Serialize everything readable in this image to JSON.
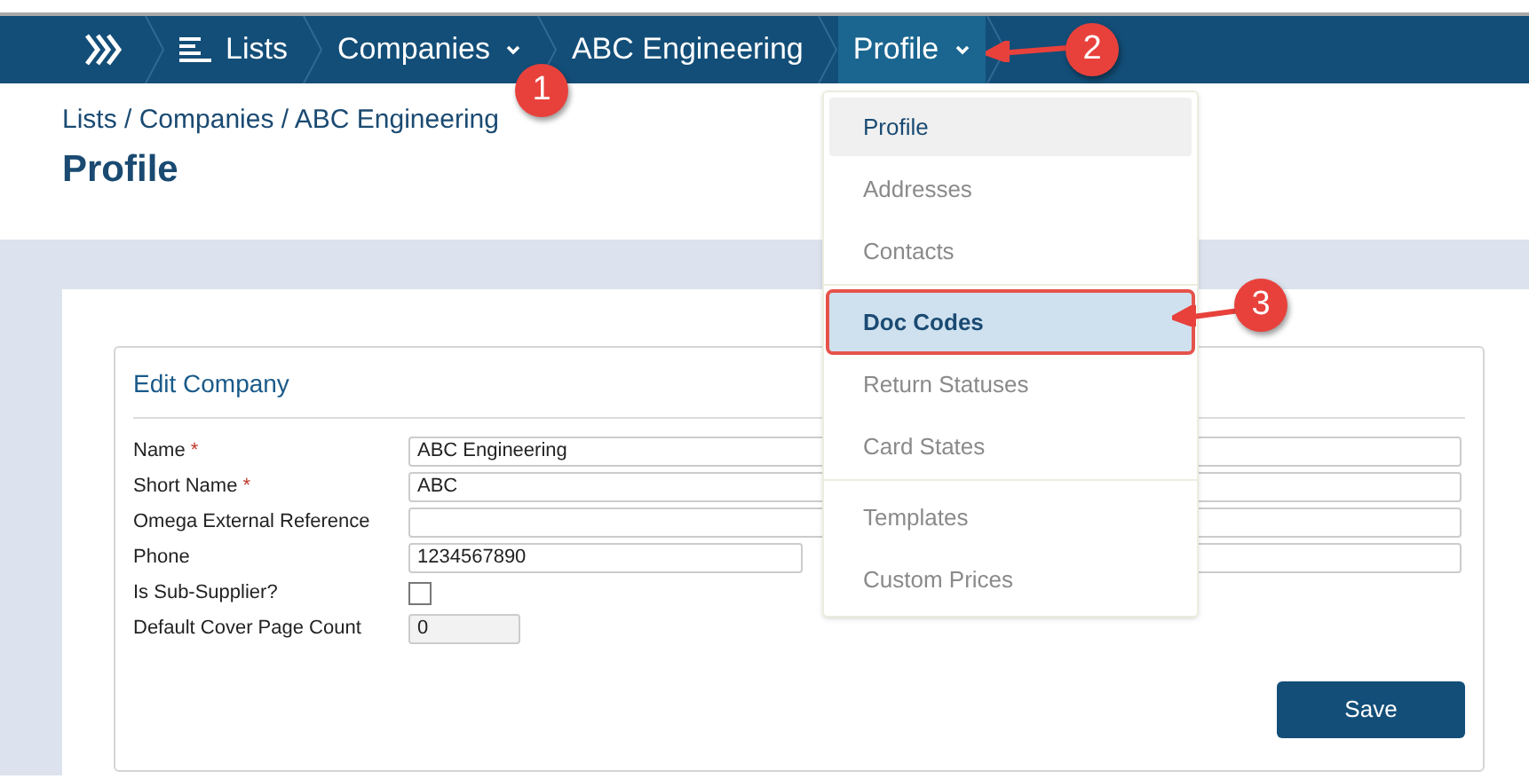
{
  "nav": {
    "items": [
      {
        "kind": "lists",
        "label": "Lists",
        "dropdown": false,
        "selected": false
      },
      {
        "kind": "plain",
        "label": "Companies",
        "dropdown": true,
        "selected": false
      },
      {
        "kind": "plain",
        "label": "ABC Engineering",
        "dropdown": false,
        "selected": false
      },
      {
        "kind": "plain",
        "label": "Profile",
        "dropdown": true,
        "selected": true
      }
    ]
  },
  "breadcrumb": "Lists / Companies / ABC Engineering",
  "title": "Profile",
  "form": {
    "title": "Edit Company",
    "fields": [
      {
        "kind": "text",
        "label": "Name",
        "required_mark": "*",
        "value": "ABC Engineering"
      },
      {
        "kind": "text",
        "label": "Short Name",
        "required_mark": "*",
        "value": "ABC"
      },
      {
        "kind": "text",
        "label": "Omega External Reference"
      },
      {
        "kind": "split",
        "label": "Phone",
        "value": "1234567890"
      },
      {
        "kind": "checkbox",
        "label": "Is Sub-Supplier?",
        "checked": false
      },
      {
        "kind": "number",
        "label": "Default Cover Page Count",
        "value": "0"
      }
    ],
    "save": "Save"
  },
  "menu": {
    "groups": [
      [
        {
          "label": "Profile",
          "selected": true,
          "hovered": false
        },
        {
          "label": "Addresses",
          "selected": false,
          "hovered": false
        },
        {
          "label": "Contacts",
          "selected": false,
          "hovered": false
        }
      ],
      [
        {
          "label": "Doc Codes",
          "selected": false,
          "hovered": true
        },
        {
          "label": "Return Statuses",
          "selected": false,
          "hovered": false
        },
        {
          "label": "Card States",
          "selected": false,
          "hovered": false
        }
      ],
      [
        {
          "label": "Templates",
          "selected": false,
          "hovered": false
        },
        {
          "label": "Custom Prices",
          "selected": false,
          "hovered": false
        }
      ]
    ]
  },
  "callouts": [
    "1",
    "2",
    "3"
  ]
}
